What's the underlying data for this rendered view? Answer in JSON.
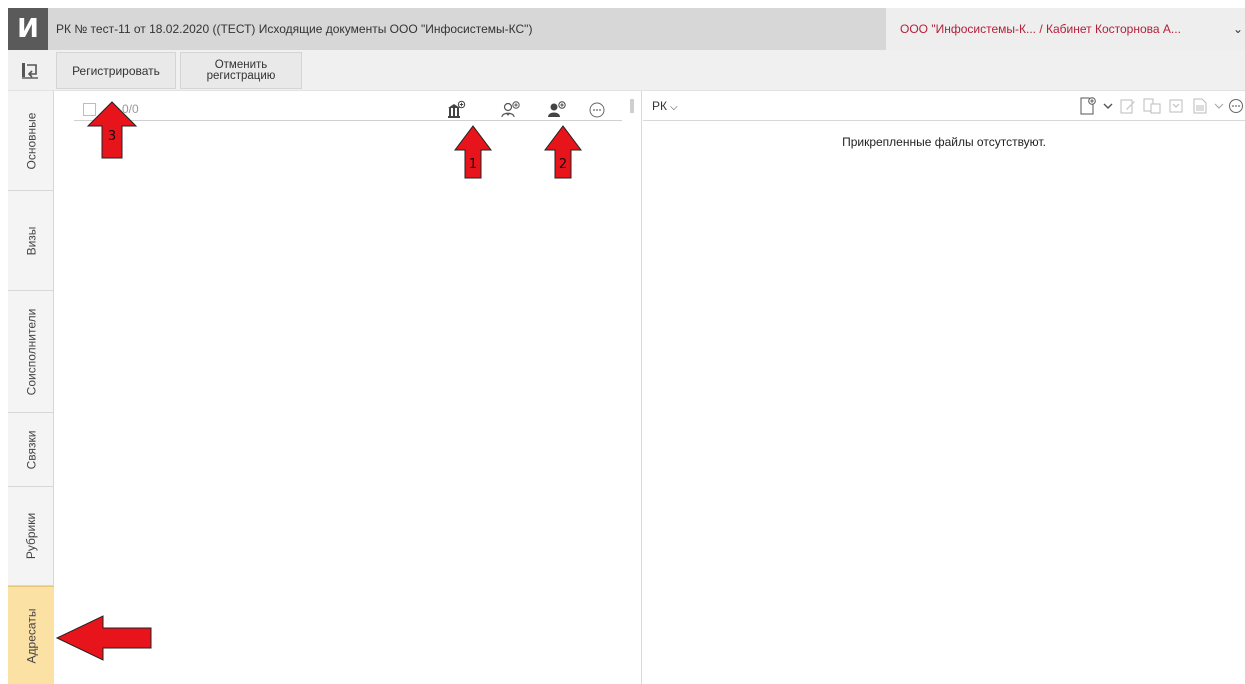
{
  "app": {
    "logo_letter": "И",
    "doc_title": "РК № тест-11 от 18.02.2020 ((ТЕСТ) Исходящие документы ООО \"Инфосистемы-КС\")",
    "org_cabinet": "ООО \"Инфосистемы-К...  / Кабинет Косторнова А..."
  },
  "toolbar": {
    "back_icon": "return-icon",
    "register_label": "Регистрировать",
    "cancel_label": "Отменить\nрегистрацию"
  },
  "side_tabs": [
    {
      "label": "Основные"
    },
    {
      "label": "Визы"
    },
    {
      "label": "Соисполнители"
    },
    {
      "label": "Связки"
    },
    {
      "label": "Рубрики"
    },
    {
      "label": "Адресаты",
      "active": true
    }
  ],
  "left_panel": {
    "counter": "0/0",
    "icons": [
      "add-organization-icon",
      "add-person-icon",
      "add-contact-icon",
      "more-icon"
    ]
  },
  "right_panel": {
    "dropdown_label": "РК",
    "no_files_text": "Прикрепленные файлы отсутствуют.",
    "tools": [
      "new-file-icon",
      "edit-icon",
      "sign-icon",
      "scan-icon",
      "document-icon",
      "more-icon"
    ]
  },
  "annotations": {
    "arrow_1": "1",
    "arrow_2": "2",
    "arrow_3": "3",
    "arrow_color": "#e8141b"
  },
  "colors": {
    "active_tab": "#fbe1a4",
    "org_text": "#b3203a",
    "titlebar": "#d7d7d7"
  }
}
